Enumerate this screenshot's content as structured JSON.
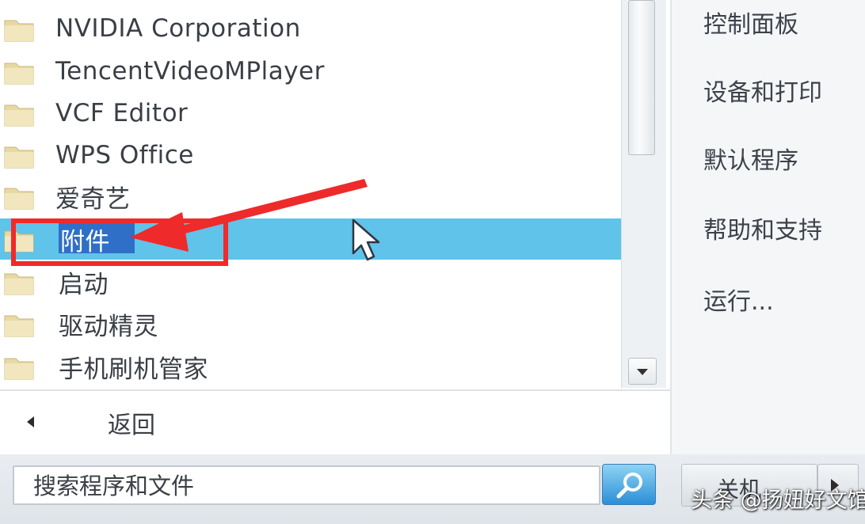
{
  "programs": {
    "items": [
      {
        "label": "NVIDIA Corporation",
        "icon": "folder-icon"
      },
      {
        "label": "TencentVideoMPlayer",
        "icon": "folder-icon"
      },
      {
        "label": "VCF Editor",
        "icon": "folder-icon"
      },
      {
        "label": "WPS Office",
        "icon": "folder-icon"
      },
      {
        "label": "爱奇艺",
        "icon": "folder-icon"
      },
      {
        "label": "附件",
        "icon": "folder-icon",
        "selected": true
      },
      {
        "label": "启动",
        "icon": "folder-icon"
      },
      {
        "label": "驱动精灵",
        "icon": "folder-icon"
      },
      {
        "label": "手机刷机管家",
        "icon": "folder-icon"
      }
    ]
  },
  "navigation": {
    "back_label": "返回"
  },
  "right_panel": {
    "items": [
      {
        "label": "控制面板"
      },
      {
        "label": "设备和打印"
      },
      {
        "label": "默认程序"
      },
      {
        "label": "帮助和支持"
      },
      {
        "label": "运行..."
      }
    ]
  },
  "search": {
    "placeholder": "搜索程序和文件"
  },
  "shutdown": {
    "label": "关机"
  },
  "watermark": {
    "text": "头条 @扬妞好文馆"
  },
  "colors": {
    "selection": "#5fc3ea",
    "annotation": "#ef2a2a",
    "folder": "#e8d9a4"
  }
}
